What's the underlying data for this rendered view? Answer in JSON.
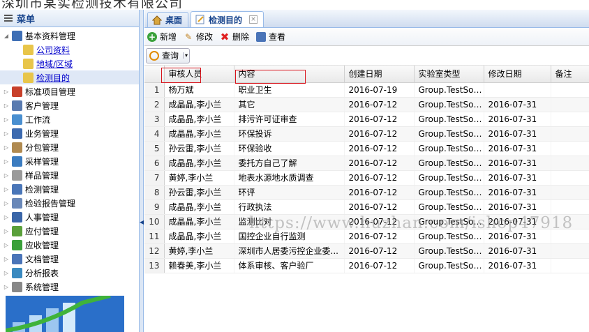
{
  "top_banner": "深圳市某实检测技术有限公司",
  "menu": {
    "title": "菜单",
    "root": "基本资料管理",
    "children": [
      "公司资料",
      "地域/区域",
      "检测目的"
    ],
    "items": [
      "标准项目管理",
      "客户管理",
      "工作流",
      "业务管理",
      "分包管理",
      "采样管理",
      "样品管理",
      "检测管理",
      "检验报告管理",
      "人事管理",
      "应付管理",
      "应收管理",
      "文档管理",
      "分析报表",
      "系统管理"
    ]
  },
  "tabs": [
    {
      "label": "桌面"
    },
    {
      "label": "检测目的",
      "close": "×"
    }
  ],
  "toolbar": {
    "add": "新增",
    "edit": "修改",
    "delete": "删除",
    "view": "查看"
  },
  "search": {
    "label": "查询",
    "arrow": "▾"
  },
  "columns": [
    "",
    "审核人员",
    "内容",
    "创建日期",
    "实验室类型",
    "修改日期",
    "备注"
  ],
  "rows": [
    [
      "1",
      "杨万斌",
      "职业卫生",
      "2016-07-19",
      "Group.TestSor...",
      "",
      ""
    ],
    [
      "2",
      "成晶晶,李小兰",
      "其它",
      "2016-07-12",
      "Group.TestSor...",
      "2016-07-31",
      ""
    ],
    [
      "3",
      "成晶晶,李小兰",
      "排污许可证审查",
      "2016-07-12",
      "Group.TestSor...",
      "2016-07-31",
      ""
    ],
    [
      "4",
      "成晶晶,李小兰",
      "环保投诉",
      "2016-07-12",
      "Group.TestSor...",
      "2016-07-31",
      ""
    ],
    [
      "5",
      "孙云雷,李小兰",
      "环保验收",
      "2016-07-12",
      "Group.TestSor...",
      "2016-07-31",
      ""
    ],
    [
      "6",
      "成晶晶,李小兰",
      "委托方自己了解",
      "2016-07-12",
      "Group.TestSor...",
      "2016-07-31",
      ""
    ],
    [
      "7",
      "黄婷,李小兰",
      "地表水源地水质调查",
      "2016-07-12",
      "Group.TestSor...",
      "2016-07-31",
      ""
    ],
    [
      "8",
      "孙云雷,李小兰",
      "环评",
      "2016-07-12",
      "Group.TestSor...",
      "2016-07-31",
      ""
    ],
    [
      "9",
      "成晶晶,李小兰",
      "行政执法",
      "2016-07-12",
      "Group.TestSor...",
      "2016-07-31",
      ""
    ],
    [
      "10",
      "成晶晶,李小兰",
      "监测比对",
      "2016-07-12",
      "Group.TestSor...",
      "2016-07-31",
      ""
    ],
    [
      "11",
      "成晶晶,李小兰",
      "国控企业自行监测",
      "2016-07-12",
      "Group.TestSor...",
      "2016-07-31",
      ""
    ],
    [
      "12",
      "黄婷,李小兰",
      "深圳市人居委污控企业委...",
      "2016-07-12",
      "Group.TestSor...",
      "2016-07-31",
      ""
    ],
    [
      "13",
      "赖春美,李小兰",
      "体系审核、客户验厂",
      "2016-07-12",
      "Group.TestSor...",
      "2016-07-31",
      ""
    ]
  ],
  "watermark": "https://www.huzhan.com/ishop47918",
  "colors": {
    "accent": "#15428b",
    "border": "#99bbe8",
    "highlight": "#d8141c"
  }
}
